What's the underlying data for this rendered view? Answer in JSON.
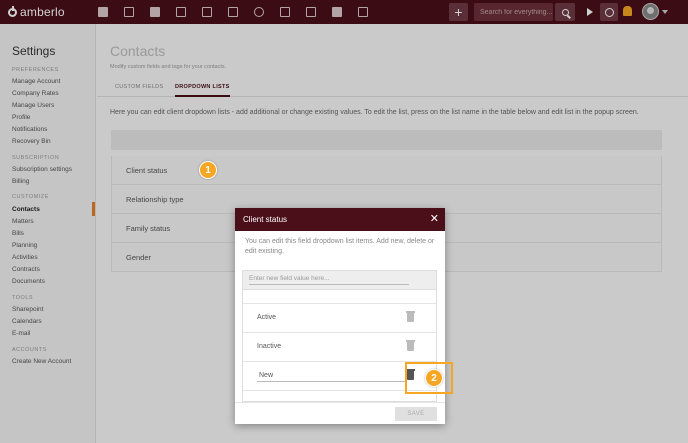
{
  "app": {
    "logo_text": "amberlo"
  },
  "topbar": {
    "nav_icons": [
      "dashboard-icon",
      "contacts-card-icon",
      "matters-briefcase-icon",
      "documents-icon",
      "bills-institution-icon",
      "planning-calendar-icon",
      "history-icon",
      "folder-icon",
      "folder-alt-icon",
      "mail-icon",
      "reports-icon"
    ],
    "add_label": "+",
    "search_placeholder": "Search for everything...",
    "notification_color": "#f5a623"
  },
  "sidebar": {
    "title": "Settings",
    "sections": [
      {
        "label": "PREFERENCES",
        "items": [
          "Manage Account",
          "Company Rates",
          "Manage Users",
          "Profile",
          "Notifications",
          "Recovery Bin"
        ]
      },
      {
        "label": "SUBSCRIPTION",
        "items": [
          "Subscription settings",
          "Billing"
        ]
      },
      {
        "label": "CUSTOMIZE",
        "items": [
          "Contacts",
          "Matters",
          "Bills",
          "Planning",
          "Activities",
          "Contracts",
          "Documents"
        ]
      },
      {
        "label": "TOOLS",
        "items": [
          "Sharepoint",
          "Calendars",
          "E-mail"
        ]
      },
      {
        "label": "ACCOUNTS",
        "items": [
          "Create New Account"
        ]
      }
    ],
    "active_item": "Contacts"
  },
  "main": {
    "title": "Contacts",
    "subtitle": "Modify custom fields and tags for your contacts.",
    "tabs": [
      {
        "label": "CUSTOM FIELDS",
        "active": false
      },
      {
        "label": "DROPDOWN LISTS",
        "active": true
      }
    ],
    "intro": "Here you can edit client dropdown lists - add additional or change existing values. To edit the list, press on the list name in the table below and edit list in the popup screen.",
    "lists": [
      "Client status",
      "Relationship type",
      "Family status",
      "Gender"
    ]
  },
  "callouts": {
    "one": "1",
    "two": "2"
  },
  "modal": {
    "title": "Client status",
    "close_label": "✕",
    "description": "You can edit this field dropdown list items. Add new, delete or edit existing.",
    "input_placeholder": "Enter new field value here...",
    "items": [
      "Active",
      "Inactive"
    ],
    "editing_value": "New",
    "save_label": "SAVE"
  },
  "colors": {
    "brand": "#4a0f19",
    "accent": "#f5a623"
  }
}
